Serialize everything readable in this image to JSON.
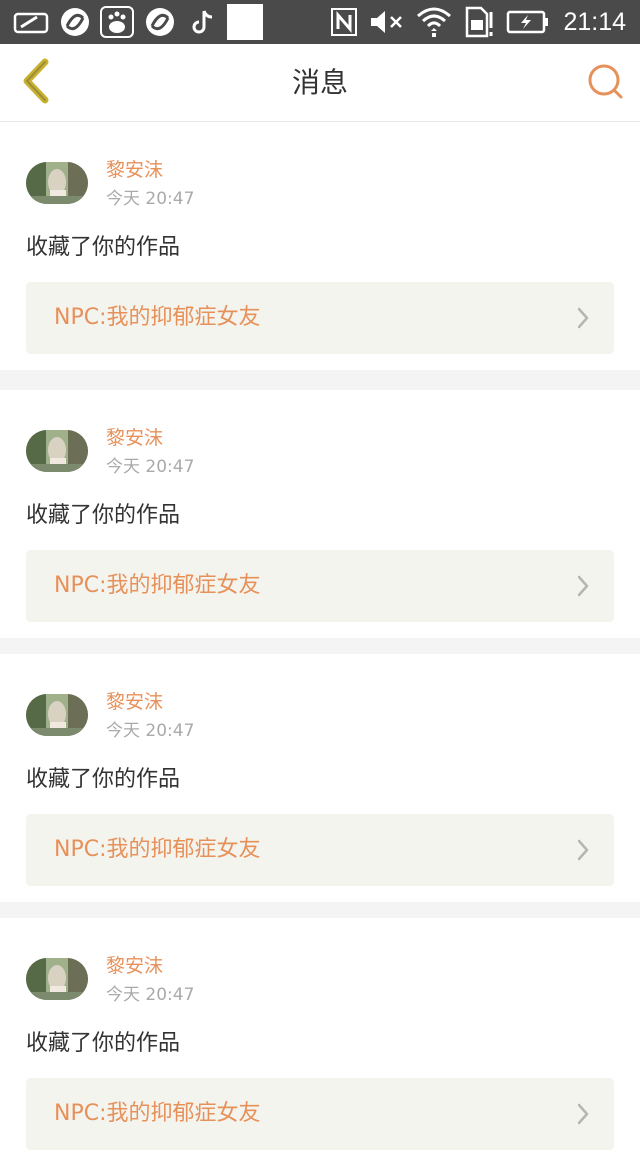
{
  "status_bar": {
    "time": "21:14",
    "icons": [
      "wallet-icon",
      "app-icon",
      "baidu-icon",
      "app-icon",
      "tiktok-icon",
      "blank-notification-icon",
      "nfc-icon",
      "mute-icon",
      "wifi-icon",
      "sim-icon",
      "battery-charging-icon"
    ]
  },
  "header": {
    "title": "消息",
    "back_icon": "chevron-left-icon",
    "search_icon": "search-icon",
    "accent_color": "#e7915a",
    "back_color": "#c9b230"
  },
  "messages": [
    {
      "user": "黎安沫",
      "time": "今天 20:47",
      "text": "收藏了你的作品",
      "work_title": "NPC:我的抑郁症女友"
    },
    {
      "user": "黎安沫",
      "time": "今天 20:47",
      "text": "收藏了你的作品",
      "work_title": "NPC:我的抑郁症女友"
    },
    {
      "user": "黎安沫",
      "time": "今天 20:47",
      "text": "收藏了你的作品",
      "work_title": "NPC:我的抑郁症女友"
    },
    {
      "user": "黎安沫",
      "time": "今天 20:47",
      "text": "收藏了你的作品",
      "work_title": "NPC:我的抑郁症女友"
    }
  ]
}
